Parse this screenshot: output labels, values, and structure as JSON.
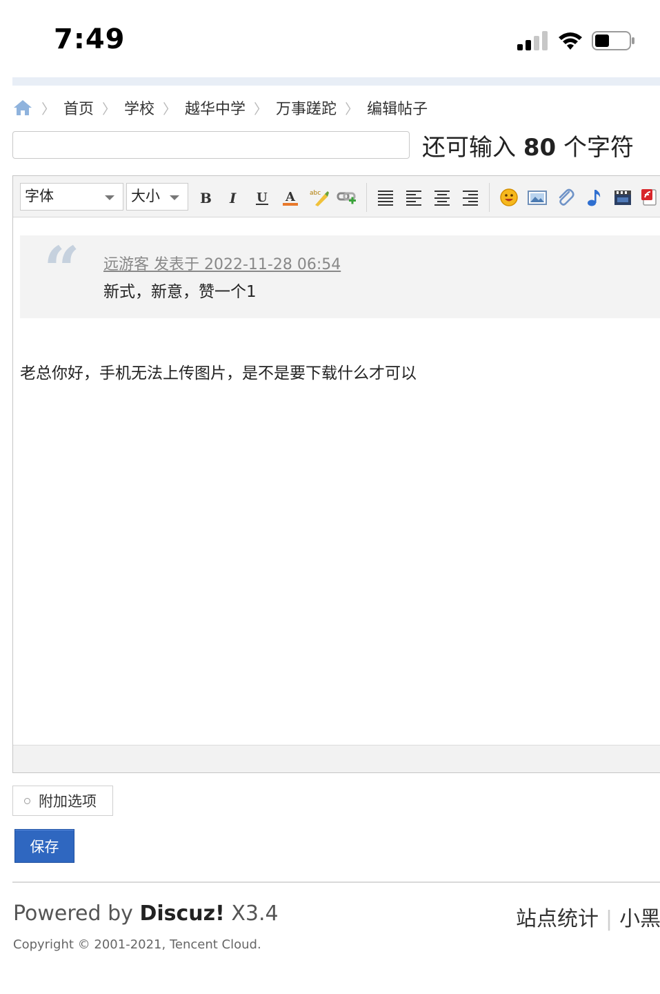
{
  "status_bar": {
    "time": "7:49"
  },
  "breadcrumb": {
    "items": [
      "首页",
      "学校",
      "越华中学",
      "万事蹉跎",
      "编辑帖子"
    ]
  },
  "subject": {
    "value": "",
    "char_prefix": "还可输入",
    "char_count": "80",
    "char_suffix": "个字符"
  },
  "toolbar": {
    "font_label": "字体",
    "size_label": "大小"
  },
  "quote": {
    "author": "远游客 发表于 2022-11-28 06:54",
    "text": "新式，新意，赞一个1"
  },
  "editor_body": "老总你好，手机无法上传图片，是不是要下载什么才可以",
  "extra_options_label": "附加选项",
  "save_label": "保存",
  "footer": {
    "powered_prefix": "Powered by",
    "brand": "Discuz!",
    "version": "X3.4",
    "copyright": "Copyright © 2001-2021, Tencent Cloud.",
    "links": [
      "站点统计",
      "小黑"
    ]
  },
  "colors": {
    "accent": "#2f67c0",
    "quote_bg": "#f3f3f3",
    "topbar": "#e8eef6"
  }
}
